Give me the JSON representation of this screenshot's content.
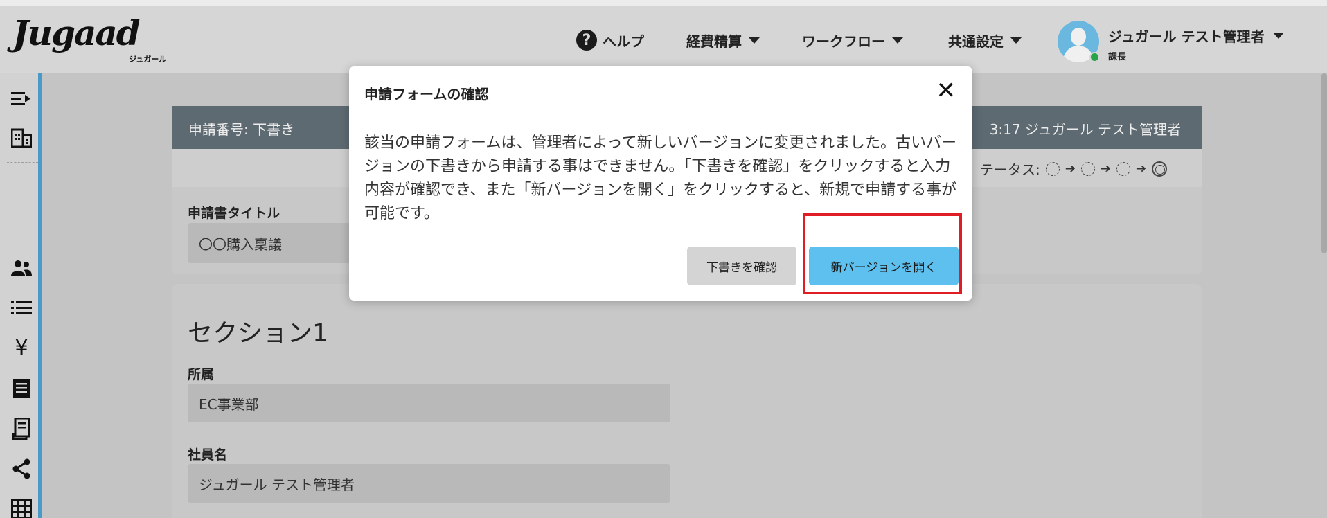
{
  "header": {
    "logo_text": "Jugaad",
    "logo_sub": "ジュガール",
    "nav": {
      "help": "ヘルプ",
      "expense": "経費精算",
      "workflow": "ワークフロー",
      "common_settings": "共通設定"
    },
    "user": {
      "name": "ジュガール テスト管理者",
      "role": "課長"
    }
  },
  "background_form": {
    "card_header_left": "申請番号: 下書き",
    "card_header_right": "3:17  ジュガール テスト管理者",
    "status_label": "テータス:",
    "title_label": "申請書タイトル",
    "title_value": "〇〇購入稟議",
    "section_title": "セクション1",
    "fields": [
      {
        "label": "所属",
        "value": "EC事業部"
      },
      {
        "label": "社員名",
        "value": "ジュガール テスト管理者"
      }
    ]
  },
  "modal": {
    "title": "申請フォームの確認",
    "body": "該当の申請フォームは、管理者によって新しいバージョンに変更されました。古いバージョンの下書きから申請する事はできません。「下書きを確認」をクリックすると入力内容が確認でき、また「新バージョンを開く」をクリックすると、新規で申請する事が可能です。",
    "buttons": {
      "review_draft": "下書きを確認",
      "open_new_version": "新バージョンを開く"
    }
  },
  "colors": {
    "primary_button": "#5ec0ee",
    "highlight_border": "#e01c24",
    "card_header": "#5e6a72",
    "sidebar_accent": "#4a9ac9"
  }
}
